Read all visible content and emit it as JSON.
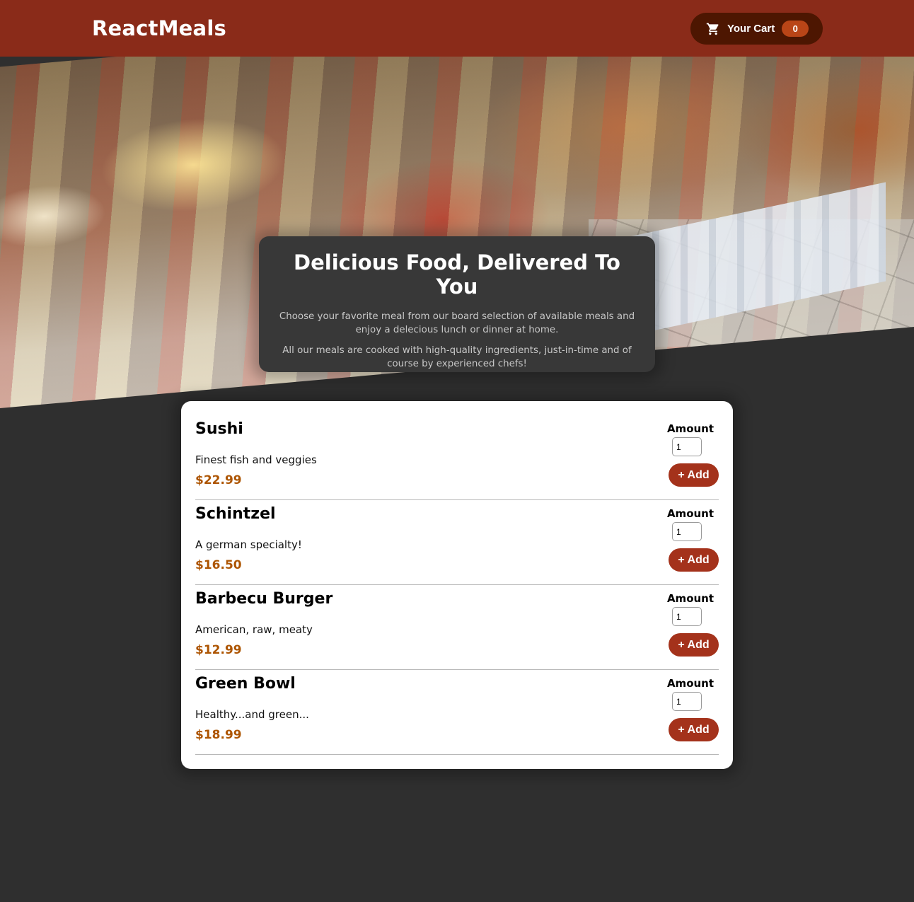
{
  "header": {
    "brand": "ReactMeals",
    "cart": {
      "icon": "shopping-cart-icon",
      "label": "Your Cart",
      "count": "0"
    }
  },
  "hero": {
    "image": "buffet-table-photo"
  },
  "summary": {
    "title": "Delicious Food, Delivered To You",
    "paragraph1": "Choose your favorite meal from our board selection of available meals and enjoy a delecious lunch or dinner at home.",
    "paragraph2": "All our meals are cooked with high-quality ingredients, just-in-time and of course by experienced chefs!"
  },
  "meals": [
    {
      "name": "Sushi",
      "description": "Finest fish and veggies",
      "price": "$22.99",
      "amount_label": "Amount",
      "amount": "1",
      "add_label": "+ Add"
    },
    {
      "name": "Schintzel",
      "description": "A german specialty!",
      "price": "$16.50",
      "amount_label": "Amount",
      "amount": "1",
      "add_label": "+ Add"
    },
    {
      "name": "Barbecu Burger",
      "description": "American, raw, meaty",
      "price": "$12.99",
      "amount_label": "Amount",
      "amount": "1",
      "add_label": "+ Add"
    },
    {
      "name": "Green Bowl",
      "description": "Healthy...and green...",
      "price": "$18.99",
      "amount_label": "Amount",
      "amount": "1",
      "add_label": "+ Add"
    }
  ],
  "colors": {
    "header": "#8a2b19",
    "cart_button": "#4d1601",
    "cart_badge": "#b94517",
    "page_background": "#2f2f2f",
    "price": "#ad5502",
    "add_button": "#a4321b"
  }
}
